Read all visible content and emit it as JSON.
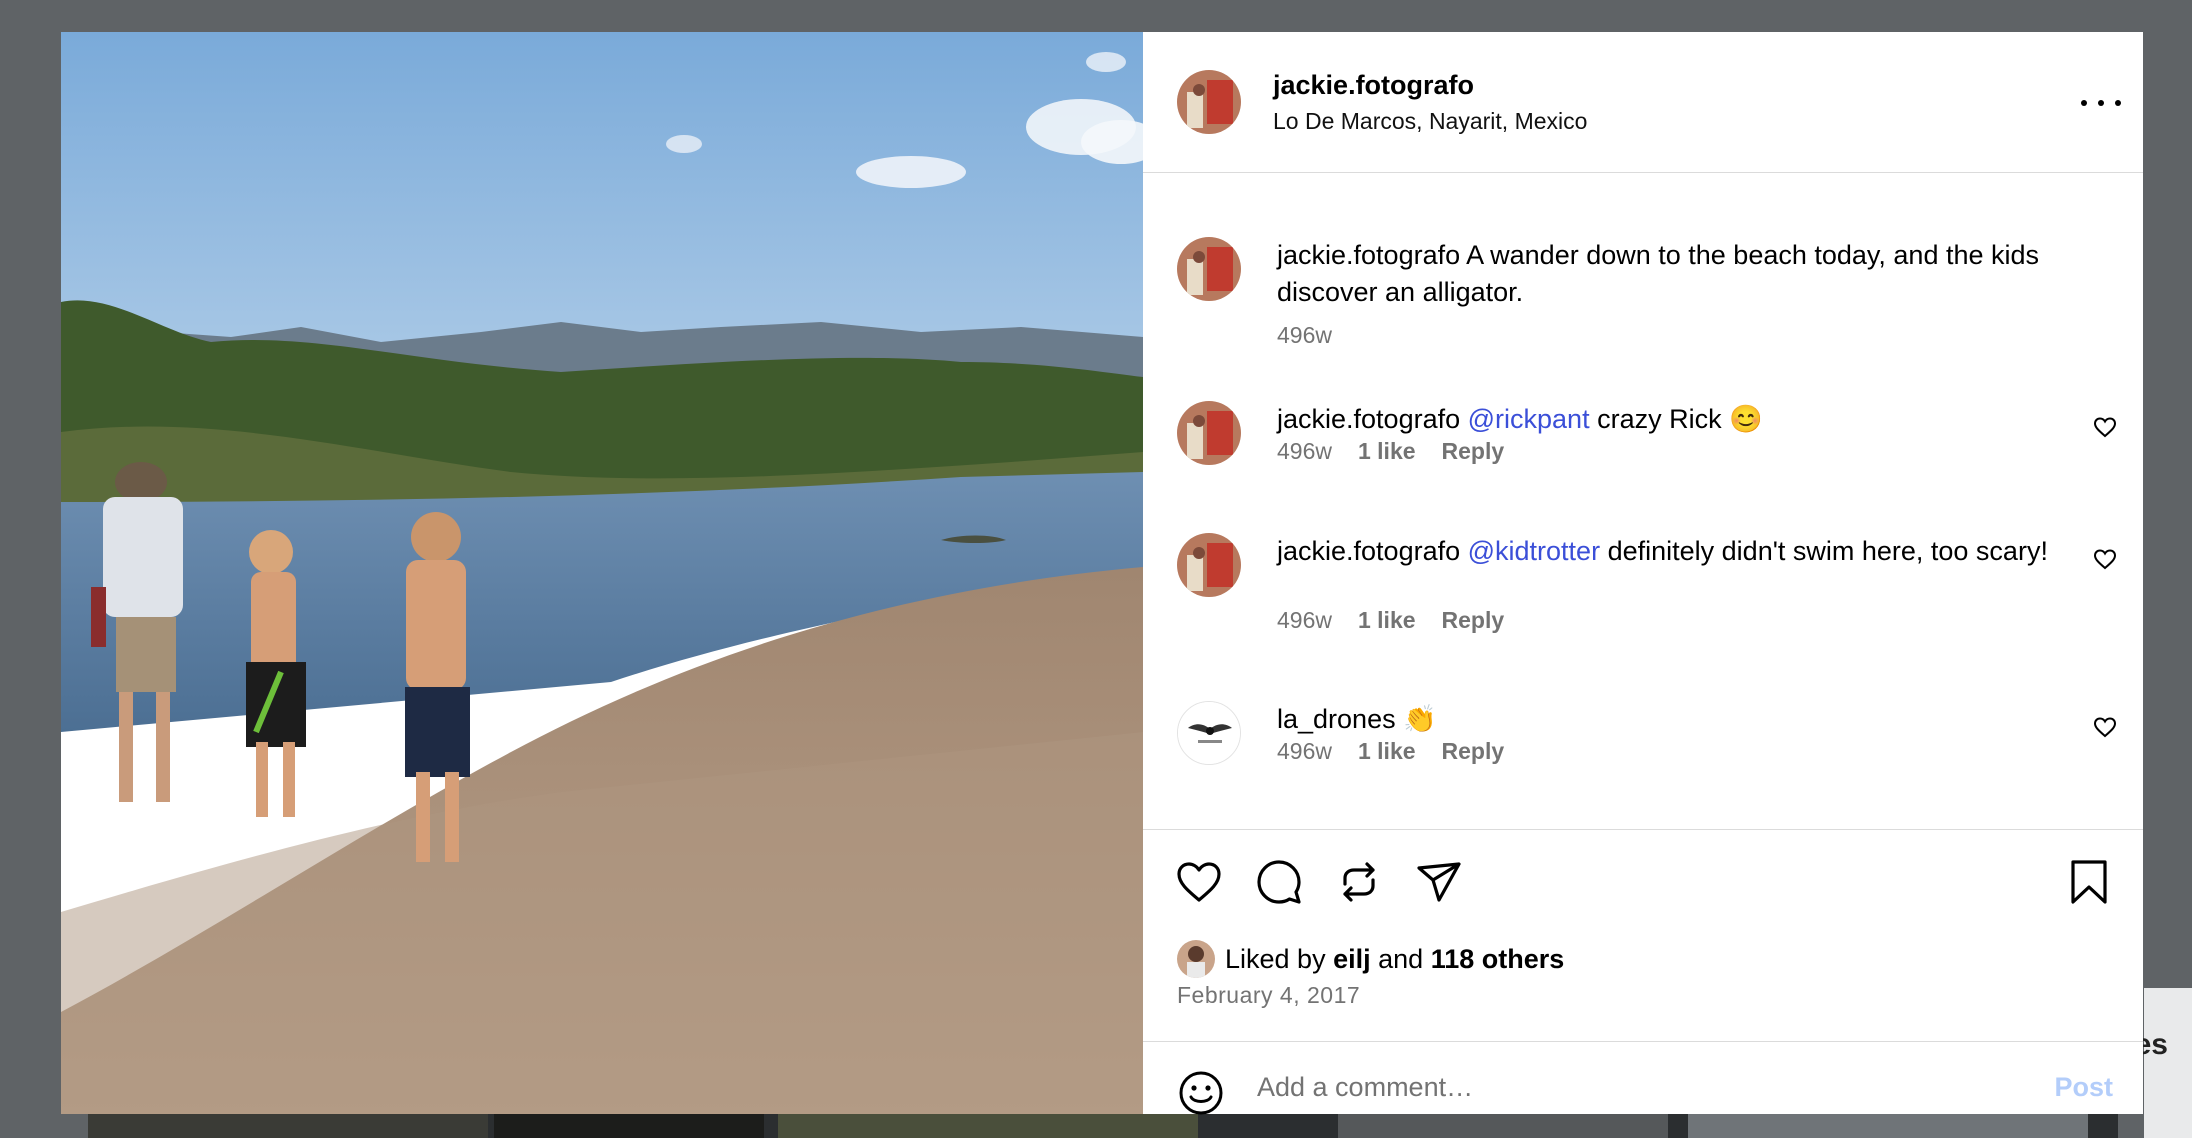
{
  "background": {
    "edge_text": "es"
  },
  "post": {
    "username": "jackie.fotografo",
    "location": "Lo De Marcos, Nayarit, Mexico",
    "more_icon": "more-horizontal-icon"
  },
  "comments": [
    {
      "username": "jackie.fotografo",
      "text": "A wander down to the beach today, and the kids discover an alligator.",
      "time": "496w",
      "is_caption": true
    },
    {
      "username": "jackie.fotografo",
      "mention": "@rickpant",
      "text": "crazy Rick 😊",
      "time": "496w",
      "likes": "1 like",
      "reply": "Reply"
    },
    {
      "username": "jackie.fotografo",
      "mention": "@kidtrotter",
      "text": "definitely didn't swim here, too scary!",
      "time": "496w",
      "likes": "1 like",
      "reply": "Reply"
    },
    {
      "username": "la_drones",
      "text": "👏",
      "time": "496w",
      "likes": "1 like",
      "reply": "Reply",
      "avatar_text": "L.A. DRONES"
    }
  ],
  "actions": {
    "like_icon": "heart-icon",
    "comment_icon": "comment-icon",
    "repost_icon": "repost-icon",
    "share_icon": "send-icon",
    "save_icon": "bookmark-icon"
  },
  "likes": {
    "prefix": "Liked by",
    "user": "eilj",
    "and": "and",
    "others": "118 others"
  },
  "date": "February 4, 2017",
  "add_comment": {
    "placeholder": "Add a comment…",
    "post_label": "Post",
    "emoji_icon": "smiley-icon"
  },
  "colors": {
    "mention": "#3b4fd8",
    "muted": "#737373",
    "post_disabled": "#b3cdfa",
    "backdrop": "#5f6366"
  }
}
